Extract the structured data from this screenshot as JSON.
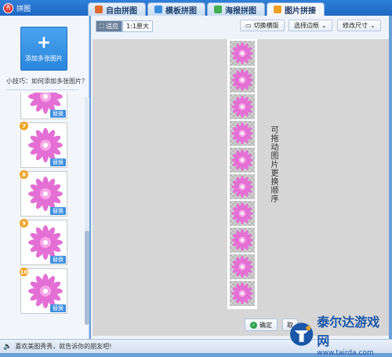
{
  "app": {
    "title": "拼图",
    "logo_text": "秀"
  },
  "tabs": [
    {
      "label": "自由拼图",
      "color": "#e06a2a"
    },
    {
      "label": "模板拼图",
      "color": "#3a8ee0"
    },
    {
      "label": "海报拼图",
      "color": "#3fae52"
    },
    {
      "label": "图片拼接",
      "color": "#f0a020"
    }
  ],
  "sidebar": {
    "add_button_plus": "+",
    "add_button_label": "添加多张图片",
    "tip": "小技巧：如何添加多张图片？",
    "thumbnails": [
      {
        "badge": "",
        "replace_label": "替换"
      },
      {
        "badge": "7",
        "replace_label": "替换"
      },
      {
        "badge": "8",
        "replace_label": "替换"
      },
      {
        "badge": "9",
        "replace_label": "替换"
      },
      {
        "badge": "10",
        "replace_label": "替换"
      }
    ]
  },
  "toolbar": {
    "fit_label": "适应",
    "original_label": "1:1原大",
    "switch_direction_label": "切换横版",
    "select_border_label": "选择边框",
    "resize_label": "修改尺寸"
  },
  "canvas": {
    "hint_text": "可拖动图片更换顺序",
    "cell_count": 10
  },
  "actions": {
    "ok_label": "确定",
    "cancel_label": "取"
  },
  "statusbar": {
    "text": "喜欢美图秀秀，就告诉你的朋友吧!"
  },
  "watermark": {
    "title": "泰尔达游戏网",
    "url": "www.tairda.com"
  },
  "colors": {
    "flower_petal": "#e46fd4",
    "flower_center": "#f7a6e8",
    "accent": "#2b86dc"
  }
}
